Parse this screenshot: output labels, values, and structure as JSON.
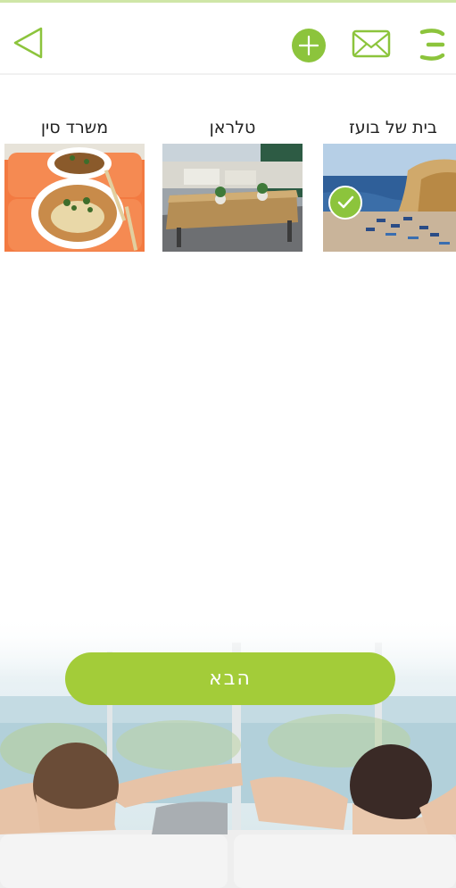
{
  "colors": {
    "accent": "#8cc43c",
    "button": "#a3cc39"
  },
  "header": {
    "icons": [
      "back-icon",
      "add-icon",
      "mail-icon",
      "menu-icon"
    ]
  },
  "places": [
    {
      "label": "בית של בועז",
      "selected": true
    },
    {
      "label": "טלראן",
      "selected": false
    },
    {
      "label": "משרד סין",
      "selected": false
    }
  ],
  "next_label": "הבא"
}
